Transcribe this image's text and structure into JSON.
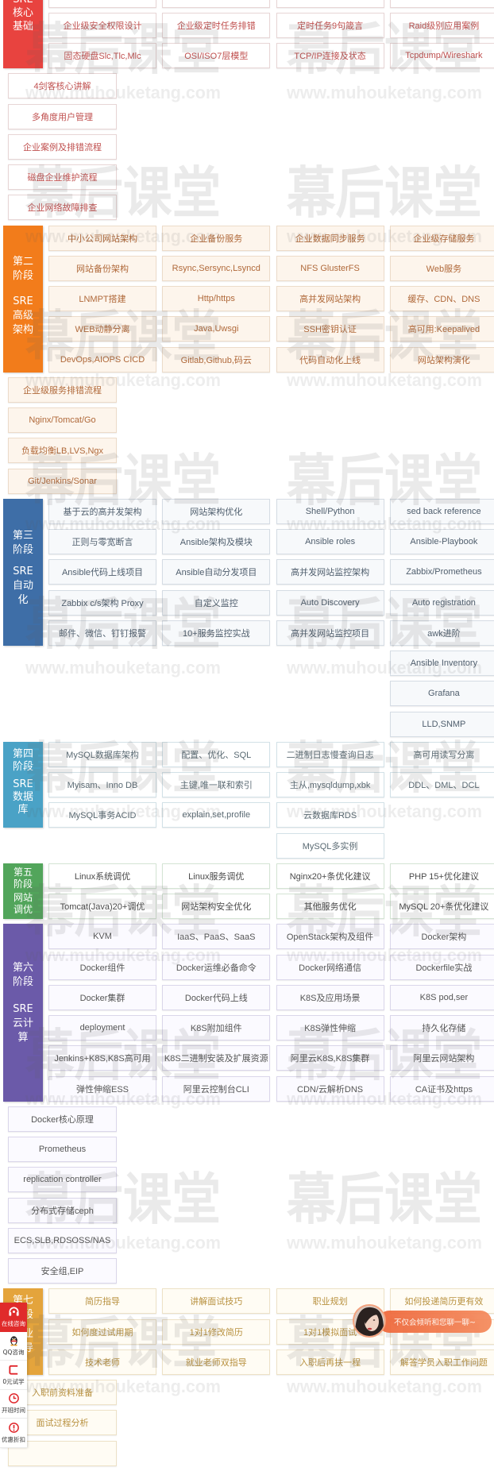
{
  "watermark": {
    "brand": "幕后课堂",
    "url": "www.muhouketang.com"
  },
  "stages": [
    {
      "theme": {
        "accent": "#e8433f",
        "card_bg": "#ffffff",
        "card_border": "#e7d5d5",
        "text": "#c0504f"
      },
      "label": {
        "stage": [],
        "topic": [
          "SRE",
          "核心",
          "基础"
        ]
      },
      "rows": [
        [
          "",
          "",
          "",
          ""
        ],
        [
          "企业级安全权限设计",
          "企业级定时任务排错",
          "定时任务9句箴言",
          "Raid级别应用案例"
        ],
        [
          "固态硬盘Slc,Tlc,Mlc",
          "OSI/ISO7层模型",
          "TCP/IP连接及状态",
          "Tcpdump/Wireshark"
        ]
      ],
      "tail_rows": [],
      "stack": [
        "4剑客核心讲解",
        "多角度用户管理",
        "企业案例及排错流程",
        "磁盘企业维护流程",
        "企业网络故障排查"
      ]
    },
    {
      "theme": {
        "accent": "#f27c1b",
        "card_bg": "#fdf5ec",
        "card_border": "#ecdbc9",
        "text": "#b0693a"
      },
      "label": {
        "stage": [
          "第二",
          "阶段"
        ],
        "topic": [
          "SRE",
          "高级",
          "架构"
        ]
      },
      "rows": [
        [
          "中小公司网站架构",
          "企业备份服务",
          "企业数据同步服务",
          "企业级存储服务"
        ],
        [
          "网站备份架构",
          "Rsync,Sersync,Lsyncd",
          "NFS GlusterFS",
          "Web服务"
        ],
        [
          "LNMPT搭建",
          "Http/https",
          "高并发网站架构",
          "缓存、CDN、DNS"
        ],
        [
          "WEB动静分离",
          "Java,Uwsgi",
          "SSH密钥认证",
          "高可用:Keepalived"
        ],
        [
          "DevOps,AIOPS CICD",
          "Gitlab,Github,码云",
          "代码自动化上线",
          "网站架构演化"
        ]
      ],
      "tail_rows": [],
      "stack": [
        "企业级服务排错流程",
        "Nginx/Tomcat/Go",
        "负载均衡LB,LVS,Ngx",
        "Git/Jenkins/Sonar"
      ]
    },
    {
      "theme": {
        "accent": "#3e6ea7",
        "card_bg": "#f7f9fb",
        "card_border": "#d5dce4",
        "text": "#4f5e6d"
      },
      "label": {
        "stage": [
          "第三",
          "阶段"
        ],
        "topic": [
          "SRE",
          "自动",
          "化"
        ]
      },
      "rows": [
        [
          "基于云的高并发架构",
          "网站架构优化",
          "Shell/Python",
          "sed back reference"
        ],
        [
          "正则与零宽断言",
          "Ansible架构及模块",
          "Ansible roles",
          "Ansible-Playbook"
        ],
        [
          "Ansible代码上线项目",
          "Ansible自动分发项目",
          "高并发网站监控架构",
          "Zabbix/Prometheus"
        ],
        [
          "Zabbix c/s架构 Proxy",
          "自定义监控",
          "Auto Discovery",
          "Auto registration"
        ],
        [
          "邮件、微信、钉钉报警",
          "10+服务监控实战",
          "高并发网站监控项目",
          "awk进阶"
        ]
      ],
      "tail_rows": [
        [
          null,
          null,
          null,
          "Ansible Inventory"
        ],
        [
          null,
          null,
          null,
          "Grafana"
        ],
        [
          null,
          null,
          null,
          "LLD,SNMP"
        ]
      ],
      "stack": []
    },
    {
      "theme": {
        "accent": "#4aa2c6",
        "card_bg": "#ffffff",
        "card_border": "#d2e1e7",
        "text": "#5a6a73"
      },
      "label": {
        "stage": [
          "第四",
          "阶段"
        ],
        "topic": [
          "SRE",
          "数据",
          "库"
        ]
      },
      "rows": [
        [
          "MySQL数据库架构",
          "配置、优化、SQL",
          "二进制日志慢查询日志",
          "高可用读写分离"
        ],
        [
          "Myisam、Inno DB",
          "主键,唯一联和索引",
          "主从,mysqldump,xbk",
          "DDL、DML、DCL"
        ],
        [
          "MySQL事务ACID",
          "explain,set,profile",
          "云数据库RDS",
          null
        ]
      ],
      "tail_rows": [
        [
          null,
          null,
          "MySQL多实例",
          null
        ]
      ],
      "stack": []
    },
    {
      "theme": {
        "accent": "#52a55b",
        "card_bg": "#ffffff",
        "card_border": "#d4e4d4",
        "text": "#4a4a4a"
      },
      "label": {
        "stage": [
          "第五",
          "阶段"
        ],
        "topic": [
          "网站",
          "调优"
        ]
      },
      "rows": [
        [
          "Linux系统调优",
          "Linux服务调优",
          "Nginx20+条优化建议",
          "PHP 15+优化建议"
        ],
        [
          "Tomcat(Java)20+调优",
          "网站架构安全优化",
          "其他服务优化",
          "MySQL 20+条优化建议"
        ]
      ],
      "tail_rows": [],
      "stack": []
    },
    {
      "theme": {
        "accent": "#6b5aa9",
        "card_bg": "#fbfaff",
        "card_border": "#dad6ea",
        "text": "#555555"
      },
      "label": {
        "stage": [
          "第六",
          "阶段"
        ],
        "topic": [
          "SRE",
          "云计",
          "算"
        ]
      },
      "rows": [
        [
          "KVM",
          "IaaS、PaaS、SaaS",
          "OpenStack架构及组件",
          "Docker架构"
        ],
        [
          "Docker组件",
          "Docker运维必备命令",
          "Docker网络通信",
          "Dockerfile实战"
        ],
        [
          "Docker集群",
          "Docker代码上线",
          "K8S及应用场景",
          "K8S pod,ser"
        ],
        [
          "deployment",
          "K8S附加组件",
          "K8S弹性伸缩",
          "持久化存储"
        ],
        [
          "Jenkins+K8S,K8S高可用",
          "K8S二进制安装及扩展资源",
          "阿里云K8S,K8S集群",
          "阿里云网站架构"
        ],
        [
          "弹性伸缩ESS",
          "阿里云控制台CLI",
          "CDN/云解析DNS",
          "CA证书及https"
        ]
      ],
      "tail_rows": [],
      "stack": [
        "Docker核心原理",
        "Prometheus",
        "replication controller",
        "分布式存储ceph",
        "ECS,SLB,RDSOSS/NAS",
        "安全组,EIP"
      ]
    },
    {
      "theme": {
        "accent": "#e4a43c",
        "card_bg": "#fffcf4",
        "card_border": "#ede1c6",
        "text": "#b8913f"
      },
      "label": {
        "stage": [
          "第七",
          "阶段"
        ],
        "topic": [
          "就业",
          "指导"
        ]
      },
      "rows": [
        [
          "简历指导",
          "讲解面试技巧",
          "职业规划",
          "如何投递简历更有效"
        ],
        [
          "如何度过试用期",
          "1对1修改简历",
          "1对1模拟面试",
          ""
        ],
        [
          "技术老师",
          "就业老师双指导",
          "入职后再扶一程",
          "解答学员入职工作问题"
        ]
      ],
      "tail_rows": [],
      "stack": [
        "入职前资料准备",
        "面试过程分析",
        ""
      ]
    }
  ],
  "float_bar": {
    "items": [
      {
        "icon": "headset-icon",
        "label": "在线咨询",
        "active": true
      },
      {
        "icon": "qq-icon",
        "label": "QQ咨询"
      },
      {
        "icon": "free-trial-icon",
        "label": "0元试学"
      },
      {
        "icon": "clock-icon",
        "label": "开班时间"
      },
      {
        "icon": "discount-alert-icon",
        "label": "优惠折扣"
      }
    ],
    "accent": "#e02b2b"
  },
  "chat_invite": {
    "message": "不仅会倾听和您聊一聊~",
    "accent": "#ee6538"
  }
}
